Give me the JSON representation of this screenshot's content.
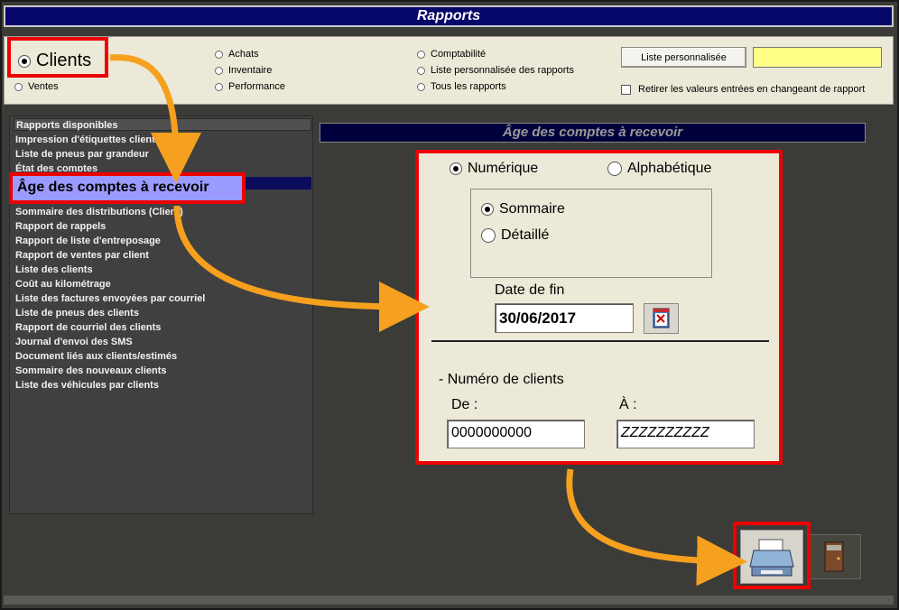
{
  "window": {
    "title": "Rapports"
  },
  "categories": {
    "clients": "Clients",
    "ventes": "Ventes",
    "achats": "Achats",
    "inventaire": "Inventaire",
    "performance": "Performance",
    "comptabilite": "Comptabilité",
    "liste_perso_rapports": "Liste personnalisée des rapports",
    "tous_rapports": "Tous les rapports",
    "selected": "Clients"
  },
  "toolbar": {
    "custom_list_button": "Liste personnalisée",
    "custom_list_value": "",
    "reset_checkbox_label": "Retirer les valeurs entrées en changeant de rapport",
    "reset_checked": false
  },
  "reports": {
    "header": "Rapports disponibles",
    "items": [
      "Impression d'étiquettes client",
      "Liste de pneus par grandeur",
      "État des comptes",
      "Âge des comptes à recevoir",
      "Sommaire des distributions (Client)",
      "Rapport de rappels",
      "Rapport de liste d'entreposage",
      "Rapport de ventes par client",
      "Liste des clients",
      "Coût au kilométrage",
      "Liste des factures envoyées par courriel",
      "Liste de pneus des clients",
      "Rapport de courriel des clients",
      "Journal d'envoi des SMS",
      "Document liés aux clients/estimés",
      "Sommaire des nouveaux clients",
      "Liste des véhicules par clients"
    ],
    "selected": "Âge des comptes à recevoir"
  },
  "form": {
    "title": "Âge des comptes à recevoir",
    "sort_numeric": "Numérique",
    "sort_alpha": "Alphabétique",
    "sort_selected": "Numérique",
    "summary": "Sommaire",
    "detailed": "Détaillé",
    "detail_selected": "Sommaire",
    "date_label": "Date de fin",
    "date_value": "30/06/2017",
    "client_range_label": "- Numéro de clients",
    "from_label": "De :",
    "to_label": "À :",
    "from_value": "0000000000",
    "to_value": "ZZZZZZZZZZ"
  },
  "colors": {
    "title_bar": "#06066a",
    "highlight_red": "#ee0000",
    "arrow_orange": "#f5a01e",
    "selected_report_bg": "#9b9bff",
    "input_yellow": "#ffff88"
  }
}
